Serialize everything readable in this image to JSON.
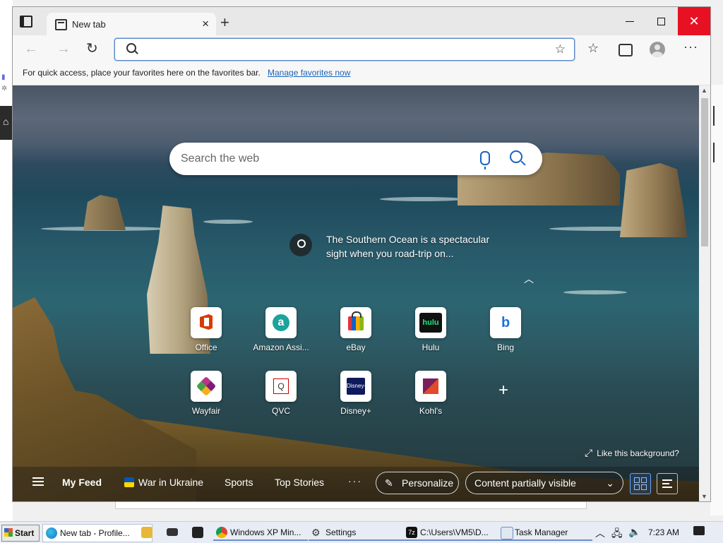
{
  "browser": {
    "tab_title": "New tab",
    "favorites_bar_message": "For quick access, place your favorites here on the favorites bar.",
    "manage_favorites_link": "Manage favorites now",
    "address_value": ""
  },
  "newtab": {
    "search_placeholder": "Search the web",
    "background_caption": "The Southern Ocean is a spectacular sight when you road-trip on...",
    "like_background": "Like this background?",
    "quick_links": [
      {
        "label": "Office",
        "icon": "office-icon"
      },
      {
        "label": "Amazon Assi...",
        "icon": "amazon-icon"
      },
      {
        "label": "eBay",
        "icon": "ebay-icon"
      },
      {
        "label": "Hulu",
        "icon": "hulu-icon"
      },
      {
        "label": "Bing",
        "icon": "bing-icon"
      },
      {
        "label": "Wayfair",
        "icon": "wayfair-icon"
      },
      {
        "label": "QVC",
        "icon": "qvc-icon"
      },
      {
        "label": "Disney+",
        "icon": "disney-icon"
      },
      {
        "label": "Kohl's",
        "icon": "kohls-icon"
      }
    ],
    "icon_glyphs": {
      "amazon": "a",
      "hulu": "hulu",
      "bing": "b",
      "qvc": "Q",
      "disney": "Disney+"
    },
    "feed": {
      "my_feed": "My Feed",
      "war_in_ukraine": "War in Ukraine",
      "sports": "Sports",
      "top_stories": "Top Stories",
      "more": "···",
      "personalize": "Personalize",
      "content_visibility": "Content partially visible"
    }
  },
  "taskbar": {
    "start": "Start",
    "tasks": [
      {
        "label": "New tab - Profile...",
        "icon": "edge-icon"
      },
      {
        "label": "",
        "icon": "folder-icon"
      },
      {
        "label": "",
        "icon": "mail-icon"
      },
      {
        "label": "",
        "icon": "store-icon"
      },
      {
        "label": "Windows XP Min...",
        "icon": "chrome-icon"
      },
      {
        "label": "Settings",
        "icon": "gear-icon"
      },
      {
        "label": "C:\\Users\\VM5\\D...",
        "icon": "7zip-icon"
      },
      {
        "label": "Task Manager",
        "icon": "task-manager-icon"
      }
    ],
    "clock": "7:23 AM"
  },
  "colors": {
    "accent": "#1664c0",
    "close_button": "#e81123",
    "link": "#1a64b8"
  }
}
